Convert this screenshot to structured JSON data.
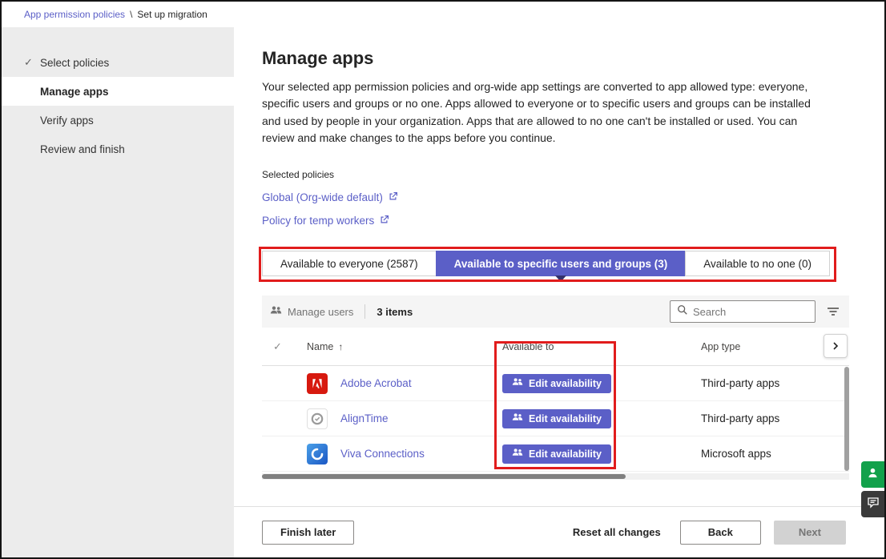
{
  "colors": {
    "accent": "#5b5fc7",
    "annotation_red": "#e11c1c",
    "sidebar_bg": "#ececec",
    "toolbar_bg": "#f5f5f5",
    "adobe_red": "#d7190f",
    "viva_blue": "#1b57c4",
    "widget_teal": "#12a14b",
    "widget_dark": "#3a3a3a"
  },
  "icons": {
    "check": "✓",
    "sort_asc": "↑"
  },
  "breadcrumb": {
    "link": "App permission policies",
    "separator": "\\",
    "current": "Set up migration"
  },
  "sidebar": {
    "items": [
      {
        "label": "Select policies",
        "state": "completed"
      },
      {
        "label": "Manage apps",
        "state": "active"
      },
      {
        "label": "Verify apps",
        "state": "upcoming"
      },
      {
        "label": "Review and finish",
        "state": "upcoming"
      }
    ]
  },
  "main": {
    "title": "Manage apps",
    "description": "Your selected app permission policies and org-wide app settings are converted to app allowed type: everyone, specific users and groups or no one. Apps allowed to everyone or to specific users and groups can be installed and used by people in your organization. Apps that are allowed to no one can't be installed or used. You can review and make changes to the apps before you continue.",
    "selected_policies_label": "Selected policies",
    "policies": [
      {
        "label": "Global (Org-wide default)"
      },
      {
        "label": "Policy for temp workers"
      }
    ],
    "tabs": [
      {
        "label": "Available to everyone (2587)",
        "active": false
      },
      {
        "label": "Available to specific users and groups (3)",
        "active": true
      },
      {
        "label": "Available to no one (0)",
        "active": false
      }
    ],
    "table": {
      "toolbar": {
        "manage_users_label": "Manage users",
        "items_count": "3 items",
        "search_placeholder": "Search"
      },
      "columns": {
        "name": "Name",
        "available_to": "Available to",
        "app_type": "App type"
      },
      "rows": [
        {
          "name": "Adobe Acrobat",
          "action_label": "Edit availability",
          "app_type": "Third-party apps",
          "icon": "adobe-acrobat-icon"
        },
        {
          "name": "AlignTime",
          "action_label": "Edit availability",
          "app_type": "Third-party apps",
          "icon": "aligntime-icon"
        },
        {
          "name": "Viva Connections",
          "action_label": "Edit availability",
          "app_type": "Microsoft apps",
          "icon": "viva-connections-icon"
        }
      ]
    },
    "footer": {
      "finish_later": "Finish later",
      "reset": "Reset all changes",
      "back": "Back",
      "next": "Next"
    }
  }
}
